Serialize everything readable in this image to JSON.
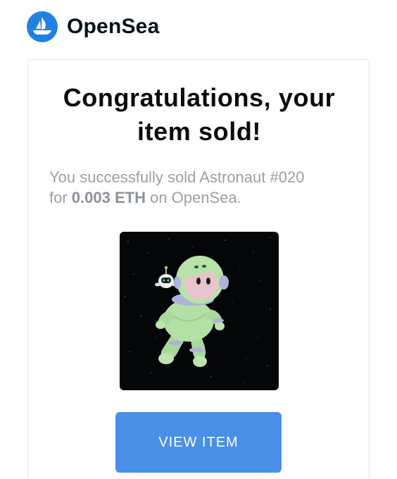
{
  "brand": {
    "name": "OpenSea",
    "logo_icon": "opensea-sailboat-logo-icon",
    "color": "#2081e2"
  },
  "email": {
    "title_line_1": "Congratulations, your",
    "title_line_2": "item sold!",
    "message_prefix_1": "You successfully sold ",
    "item_name": "Astronaut #020",
    "message_prefix_2": "for ",
    "price": "0.003 ETH",
    "message_suffix": " on OpenSea.",
    "image_icon": "astronaut-nft-image",
    "button_label": "VIEW ITEM",
    "button_color": "#4a8fe7"
  }
}
